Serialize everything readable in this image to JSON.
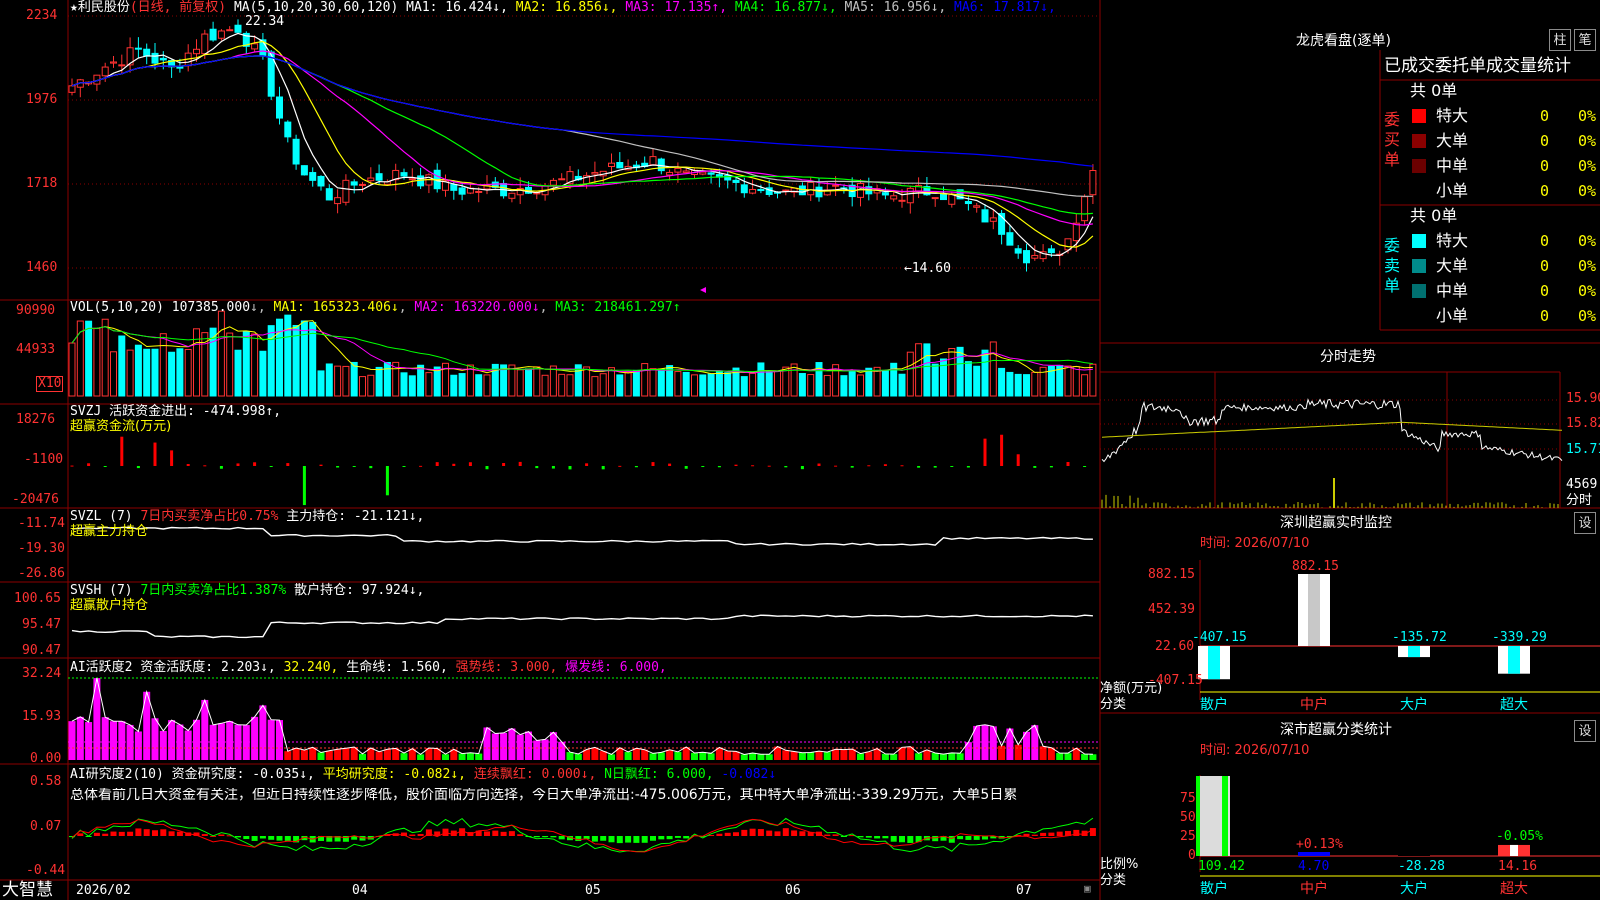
{
  "app": {
    "brand": "大智慧"
  },
  "price_panel": {
    "header_stock": "★利民股份",
    "header_mode": "(日线, 前复权)",
    "header_ma": "MA(5,10,20,30,60,120)",
    "ma_items": [
      {
        "label": "MA1:",
        "value": "16.424",
        "arrow": "↓",
        "color": "#ffffff"
      },
      {
        "label": "MA2:",
        "value": "16.856",
        "arrow": "↓",
        "color": "#ffff00"
      },
      {
        "label": "MA3:",
        "value": "17.135",
        "arrow": "↑",
        "color": "#ff00ff"
      },
      {
        "label": "MA4:",
        "value": "16.877",
        "arrow": "↓",
        "color": "#00ff00"
      },
      {
        "label": "MA5:",
        "value": "16.956",
        "arrow": "↓",
        "color": "#c0c0c0"
      },
      {
        "label": "MA6:",
        "value": "17.817",
        "arrow": "↓",
        "color": "#0000ff"
      }
    ],
    "y_ticks": [
      "2234",
      "1976",
      "1718",
      "1460"
    ],
    "high_label": "22.34",
    "low_label": "←14.60"
  },
  "vol_panel": {
    "header": "VOL(5,10,20)",
    "value": "107385.000",
    "items": [
      {
        "text": "MA1: 165323.406↓",
        "color": "#ffff00"
      },
      {
        "text": "MA2: 163220.000↓",
        "color": "#ff00ff"
      },
      {
        "text": "MA3: 218461.297↑",
        "color": "#00ff00"
      }
    ],
    "y_ticks": [
      "90990",
      "44933"
    ],
    "unit": "X10"
  },
  "svzj_panel": {
    "header": "SVZJ  活跃资金进出: -474.998↑,",
    "sub": "超赢资金流(万元)",
    "y_ticks": [
      "18276",
      "-1100",
      "-20476"
    ]
  },
  "svzl_panel": {
    "header_a": "SVZL (7)",
    "header_b": "7日内买卖净占比0.75%",
    "header_c": "主力持仓: -21.121↓,",
    "sub": "超赢主力持仓",
    "y_ticks": [
      "-11.74",
      "-19.30",
      "-26.86"
    ]
  },
  "svsh_panel": {
    "header_a": "SVSH (7)",
    "header_b": "7日内买卖净占比1.387%",
    "header_c": "散户持仓: 97.924↓,",
    "sub": "超赢散户持仓",
    "y_ticks": [
      "100.65",
      "95.47",
      "90.47"
    ]
  },
  "ai_active_panel": {
    "header_a": "AI活跃度2 资金活跃度: 2.203↓,",
    "header_b": "32.240,",
    "header_c": "生命线: 1.560,",
    "header_d": "强势线: 3.000,",
    "header_e": "爆发线: 6.000,",
    "y_ticks": [
      "32.24",
      "15.93",
      "0.00"
    ]
  },
  "ai_research_panel": {
    "header_a": "AI研究度2(10) 资金研究度: -0.035↓,",
    "header_b": "平均研究度: -0.082↓,",
    "header_c": "连续飘红: 0.000↓,",
    "header_d": "N日飘红: 6.000,",
    "header_e": "-0.082↓",
    "text": "总体看前几日大资金有关注，但近日持续性逐步降低，股价面临方向选择，今日大单净流出:-475.006万元，其中特大单净流出:-339.29万元，大单5日累",
    "y_ticks": [
      "0.58",
      "0.07",
      "-0.44"
    ]
  },
  "x_axis": [
    "2026/02",
    "04",
    "05",
    "06",
    "07"
  ],
  "dragon_panel": {
    "title": "龙虎看盘(逐单)",
    "btn_bar": "柱",
    "btn_pen": "笔",
    "tabs": "已成交委托单成交量统计",
    "buy_label": "委买单",
    "sell_label": "委卖单",
    "buy_total": "共 0单",
    "sell_total": "共 0单",
    "buy_rows": [
      {
        "name": "特大",
        "count": "0",
        "pct": "0%",
        "color": "#ff0000"
      },
      {
        "name": "大单",
        "count": "0",
        "pct": "0%",
        "color": "#8b0000"
      },
      {
        "name": "中单",
        "count": "0",
        "pct": "0%",
        "color": "#6b0000"
      },
      {
        "name": "小单",
        "count": "0",
        "pct": "0%",
        "color": ""
      }
    ],
    "sell_rows": [
      {
        "name": "特大",
        "count": "0",
        "pct": "0%",
        "color": "#00ffff"
      },
      {
        "name": "大单",
        "count": "0",
        "pct": "0%",
        "color": "#008b8b"
      },
      {
        "name": "中单",
        "count": "0",
        "pct": "0%",
        "color": "#007070"
      },
      {
        "name": "小单",
        "count": "0",
        "pct": "0%",
        "color": ""
      }
    ]
  },
  "intraday_panel": {
    "title": "分时走势",
    "y_ticks": [
      "15.90",
      "15.82",
      "15.71"
    ],
    "vol_label": "4569",
    "unit_label": "分时"
  },
  "monitor_panel": {
    "title": "深圳超赢实时监控",
    "btn": "设",
    "time": "时间: 2026/07/10",
    "y_ticks": [
      "882.15",
      "452.39",
      "22.60",
      "-407.15"
    ],
    "unit": "净额(万元)",
    "cat_label": "分类",
    "categories": [
      "散户",
      "中户",
      "大户",
      "超大"
    ],
    "values": [
      "-407.15",
      "882.15",
      "-135.72",
      "-339.29"
    ]
  },
  "class_panel": {
    "title": "深市超赢分类统计",
    "btn": "设",
    "time": "时间: 2026/07/10",
    "y_ticks": [
      "75",
      "50",
      "25",
      "0"
    ],
    "unit": "比例%",
    "cat_label": "分类",
    "categories": [
      "散户",
      "中户",
      "大户",
      "超大"
    ],
    "values": [
      "109.42",
      "4.70",
      "-28.28",
      "14.16"
    ],
    "pct_labels": [
      "",
      "+0.13%",
      "",
      "-0.05%"
    ]
  },
  "colors": {
    "up": "#ff3232",
    "down": "#00ffff",
    "grid": "#8b0000"
  }
}
